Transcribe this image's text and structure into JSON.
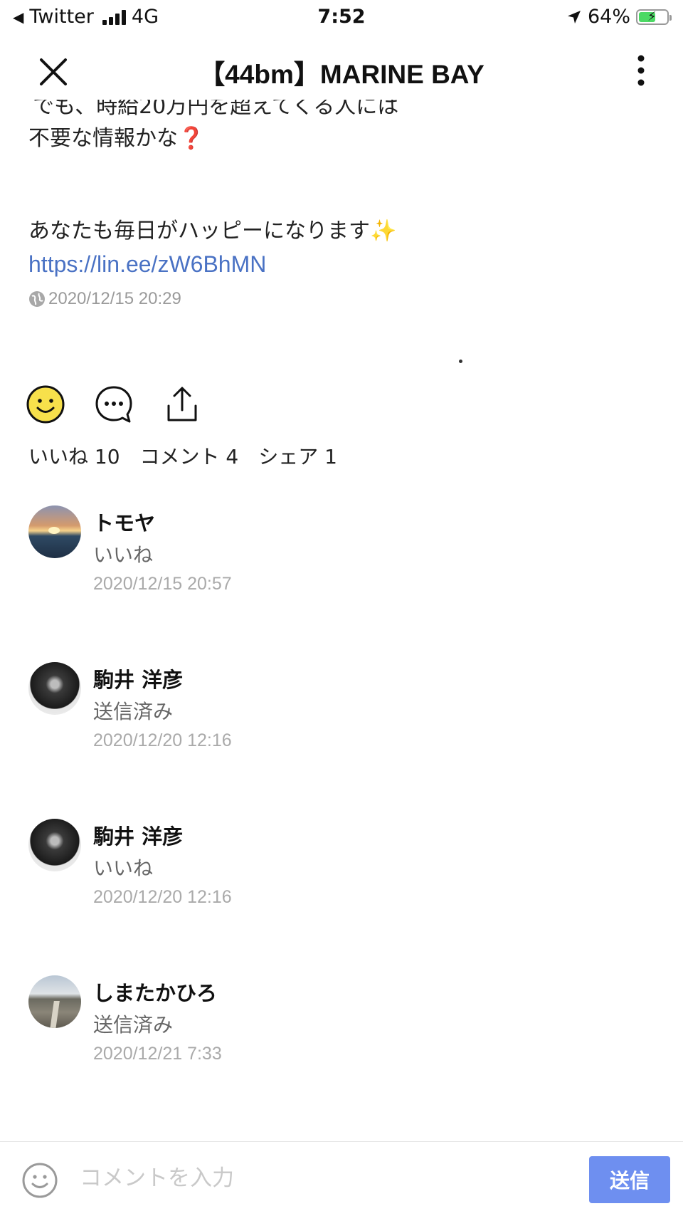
{
  "status_bar": {
    "back_app": "Twitter",
    "network": "4G",
    "time": "7:52",
    "battery": "64%",
    "battery_level": 0.64
  },
  "nav": {
    "title": "【44bm】MARINE BAY"
  },
  "post": {
    "cut_line": "でも、時給20万円を超えてくる人には",
    "line1": "不要な情報かな",
    "line1_emoji": "❓",
    "line2": "あなたも毎日がハッピーになります",
    "line2_emoji": "✨",
    "link": "https://lin.ee/zW6BhMN",
    "timestamp": "2020/12/15 20:29"
  },
  "counts": {
    "likes": "いいね 10",
    "comments": "コメント 4",
    "shares": "シェア 1"
  },
  "comments": [
    {
      "name": "トモヤ",
      "text": "いいね",
      "time": "2020/12/15 20:57"
    },
    {
      "name": "駒井 洋彦",
      "text": "送信済み",
      "time": "2020/12/20 12:16"
    },
    {
      "name": "駒井 洋彦",
      "text": "いいね",
      "time": "2020/12/20 12:16"
    },
    {
      "name": "しまたかひろ",
      "text": "送信済み",
      "time": "2020/12/21 7:33"
    }
  ],
  "bottom_bar": {
    "placeholder": "コメントを入力",
    "send_label": "送信"
  },
  "colors": {
    "link": "#4a72c4",
    "send_button": "#6e8ff0",
    "like_icon": "#f7e04b",
    "battery_fill": "#4cd964"
  },
  "icons": [
    "back-arrow-icon",
    "signal-icon",
    "location-arrow-icon",
    "battery-icon",
    "close-icon",
    "more-vertical-icon",
    "globe-icon",
    "smile-like-icon",
    "comment-bubble-icon",
    "share-icon",
    "emoji-icon"
  ]
}
